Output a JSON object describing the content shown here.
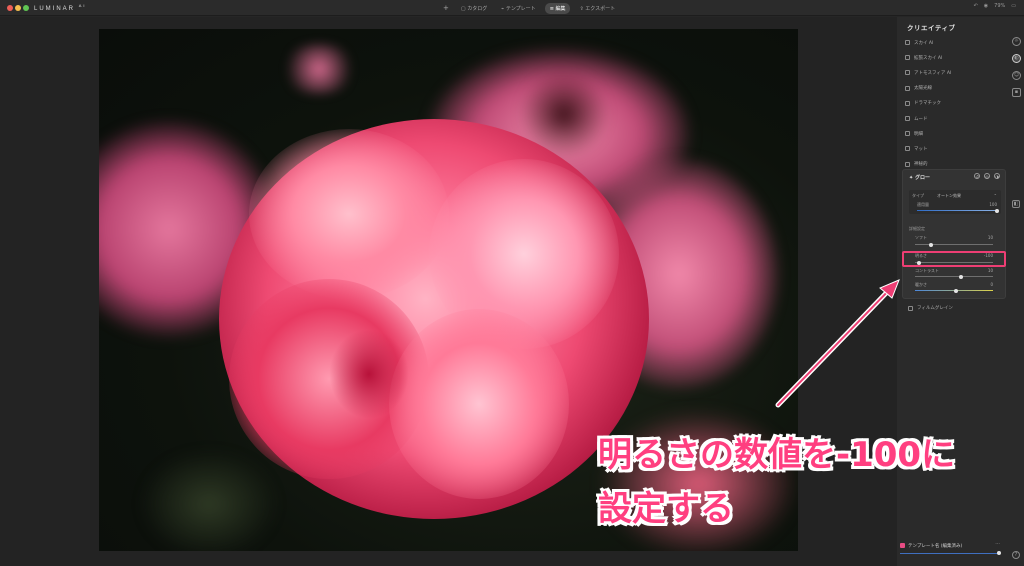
{
  "app": {
    "logo": "LUMINAR",
    "logo_version": "AI"
  },
  "nav": {
    "add": "+",
    "items": [
      {
        "label": "カタログ",
        "active": false
      },
      {
        "label": "テンプレート",
        "active": false
      },
      {
        "label": "編集",
        "active": true
      },
      {
        "label": "エクスポート",
        "active": false
      }
    ]
  },
  "top_right": {
    "zoom": "79%"
  },
  "panel": {
    "title": "クリエイティブ",
    "tools": [
      "スカイ AI",
      "拡張スカイ AI",
      "アトモスフィア AI",
      "太陽光線",
      "ドラマチック",
      "ムード",
      "明細",
      "マット",
      "神秘的"
    ],
    "glow": {
      "title": "グロー",
      "type_label": "タイプ",
      "type_value": "オートン効果",
      "amount_label": "適用量",
      "amount_value": "100",
      "advanced_label": "詳細設定",
      "sliders": [
        {
          "label": "ソフト",
          "value": "10"
        },
        {
          "label": "明るさ",
          "value": "-100"
        },
        {
          "label": "コントラスト",
          "value": "10"
        },
        {
          "label": "暖かさ",
          "value": "0"
        }
      ]
    },
    "film_grain": "フィルムグレイン"
  },
  "bottom": {
    "template_label": "テンプレート名 (編集済み)",
    "more": "···",
    "help": "?"
  },
  "annotation": {
    "line1": "明るさの数値を-100に",
    "line2": "設定する",
    "color": "#ff3f80"
  },
  "colors": {
    "accent": "#ee3e74",
    "panel_bg": "#2a2a2a",
    "slider_blue": "#2f6cc6"
  }
}
